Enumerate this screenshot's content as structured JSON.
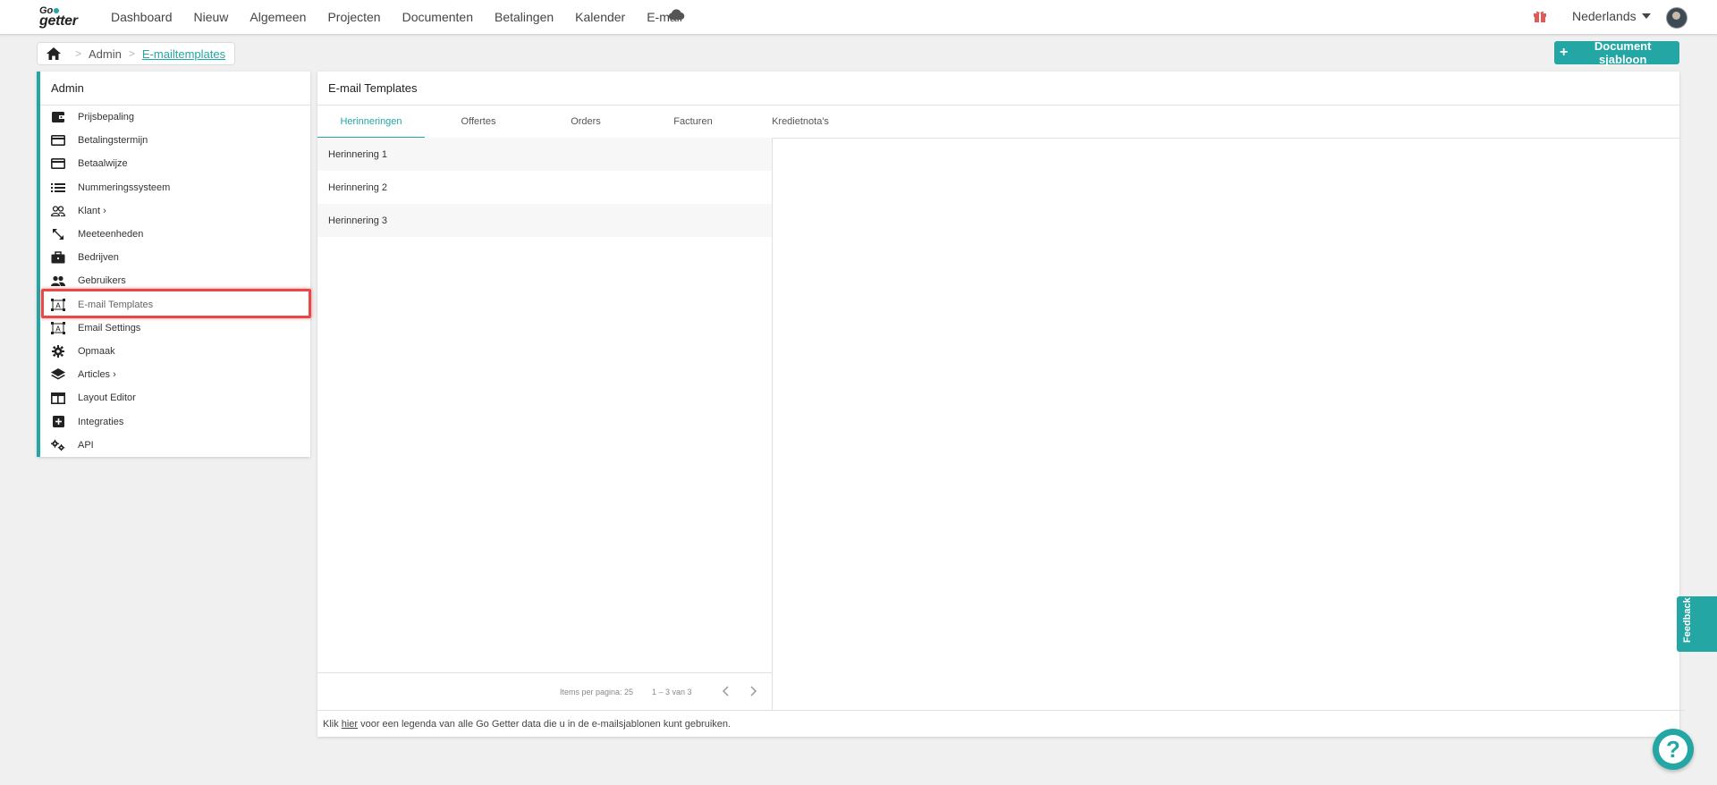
{
  "nav": {
    "logo_go": "Go",
    "logo_getter": "getter",
    "items": [
      "Dashboard",
      "Nieuw",
      "Algemeen",
      "Projecten",
      "Documenten",
      "Betalingen",
      "Kalender",
      "E-mail"
    ],
    "language": "Nederlands"
  },
  "breadcrumb": {
    "level1": "Admin",
    "level2": "E-mailtemplates"
  },
  "actions": {
    "new_template": "Document sjabloon"
  },
  "sidebar": {
    "title": "Admin",
    "items": [
      {
        "label": "Prijsbepaling",
        "icon": "wallet-icon"
      },
      {
        "label": "Betalingstermijn",
        "icon": "credit-card-icon"
      },
      {
        "label": "Betaalwijze",
        "icon": "credit-card-icon"
      },
      {
        "label": "Nummeringssysteem",
        "icon": "list-icon"
      },
      {
        "label": "Klant",
        "icon": "users-icon",
        "chevron": "›"
      },
      {
        "label": "Meeteenheden",
        "icon": "resize-arrow-icon"
      },
      {
        "label": "Bedrijven",
        "icon": "briefcase-icon"
      },
      {
        "label": "Gebruikers",
        "icon": "people-icon"
      },
      {
        "label": "E-mail Templates",
        "icon": "template-icon",
        "active": true
      },
      {
        "label": "Email Settings",
        "icon": "template-icon"
      },
      {
        "label": "Opmaak",
        "icon": "gear-icon"
      },
      {
        "label": "Articles",
        "icon": "layers-icon",
        "chevron": "›"
      },
      {
        "label": "Layout Editor",
        "icon": "layout-icon"
      },
      {
        "label": "Integraties",
        "icon": "plus-box-icon"
      },
      {
        "label": "API",
        "icon": "gears-icon"
      }
    ]
  },
  "main": {
    "title": "E-mail Templates",
    "tabs": [
      "Herinneringen",
      "Offertes",
      "Orders",
      "Facturen",
      "Kredietnota's"
    ],
    "active_tab": "Herinneringen",
    "list": [
      "Herinnering 1",
      "Herinnering 2",
      "Herinnering 3"
    ],
    "paginator": {
      "items_per_page": "Items per pagina: 25",
      "range": "1 – 3 van 3"
    },
    "footer": {
      "prefix": "Klik",
      "link": "hier",
      "suffix": "voor een legenda van alle Go Getter data die u in de e-mailsjablonen kunt gebruiken."
    }
  },
  "feedback": "Feedback",
  "help": "?",
  "colors": {
    "accent": "#23a6a4",
    "highlight": "#e84848"
  }
}
